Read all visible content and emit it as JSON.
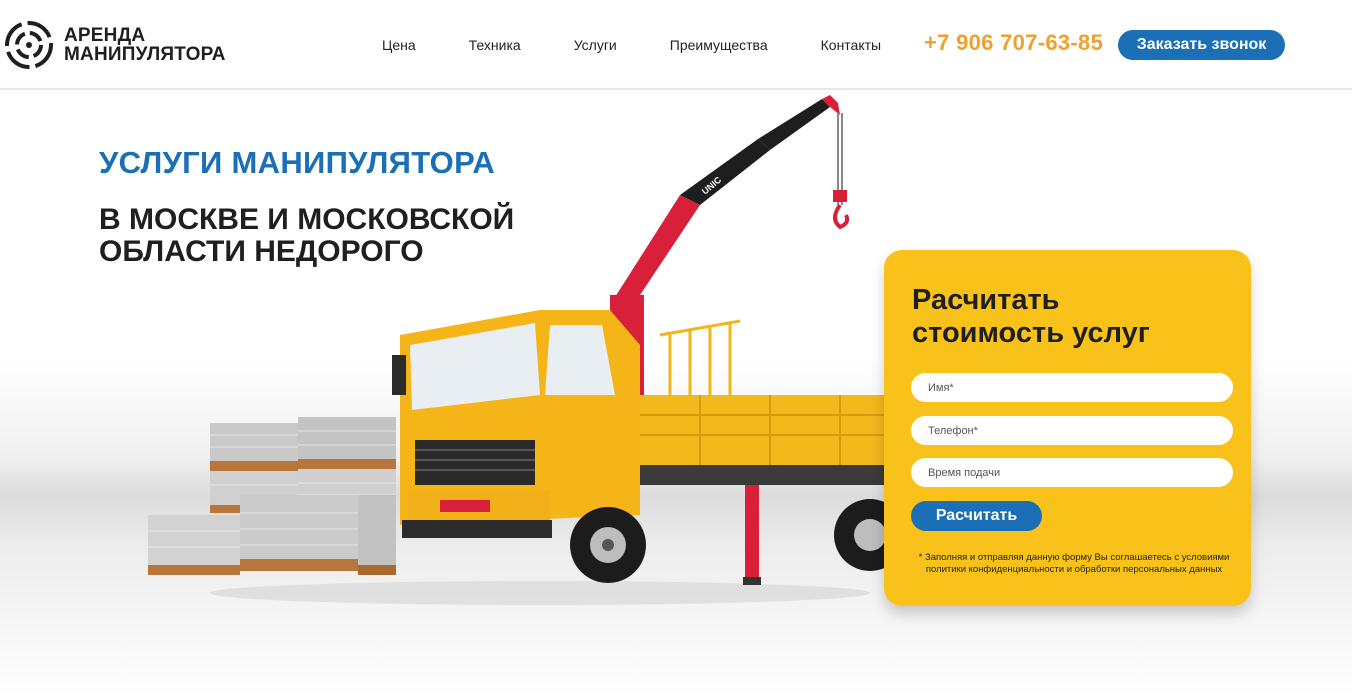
{
  "header": {
    "logo_line1": "АРЕНДА",
    "logo_line2": "МАНИПУЛЯТОРА",
    "nav": [
      "Цена",
      "Техника",
      "Услуги",
      "Преимущества",
      "Контакты"
    ],
    "phone": "+7 906 707-63-85",
    "call_button": "Заказать звонок"
  },
  "hero": {
    "title": "УСЛУГИ МАНИПУЛЯТОРА",
    "subtitle": "В МОСКВЕ И МОСКОВСКОЙ ОБЛАСТИ НЕДОРОГО",
    "truck_label": "UNIC"
  },
  "form": {
    "title": "Расчитать стоимость услуг",
    "name_placeholder": "Имя*",
    "phone_placeholder": "Телефон*",
    "time_placeholder": "Время подачи",
    "submit": "Расчитать",
    "disclaimer": "* Заполняя и отправляя данную форму Вы соглашаетесь с условиями политики конфиденциальности и обработки персональных данных"
  },
  "colors": {
    "accent_blue": "#1a6fb7",
    "phone_orange": "#f0a02e",
    "form_yellow": "#f9c21a",
    "truck_yellow": "#f5b417",
    "crane_red": "#d9203a"
  },
  "icons": [
    "logo-icon"
  ]
}
